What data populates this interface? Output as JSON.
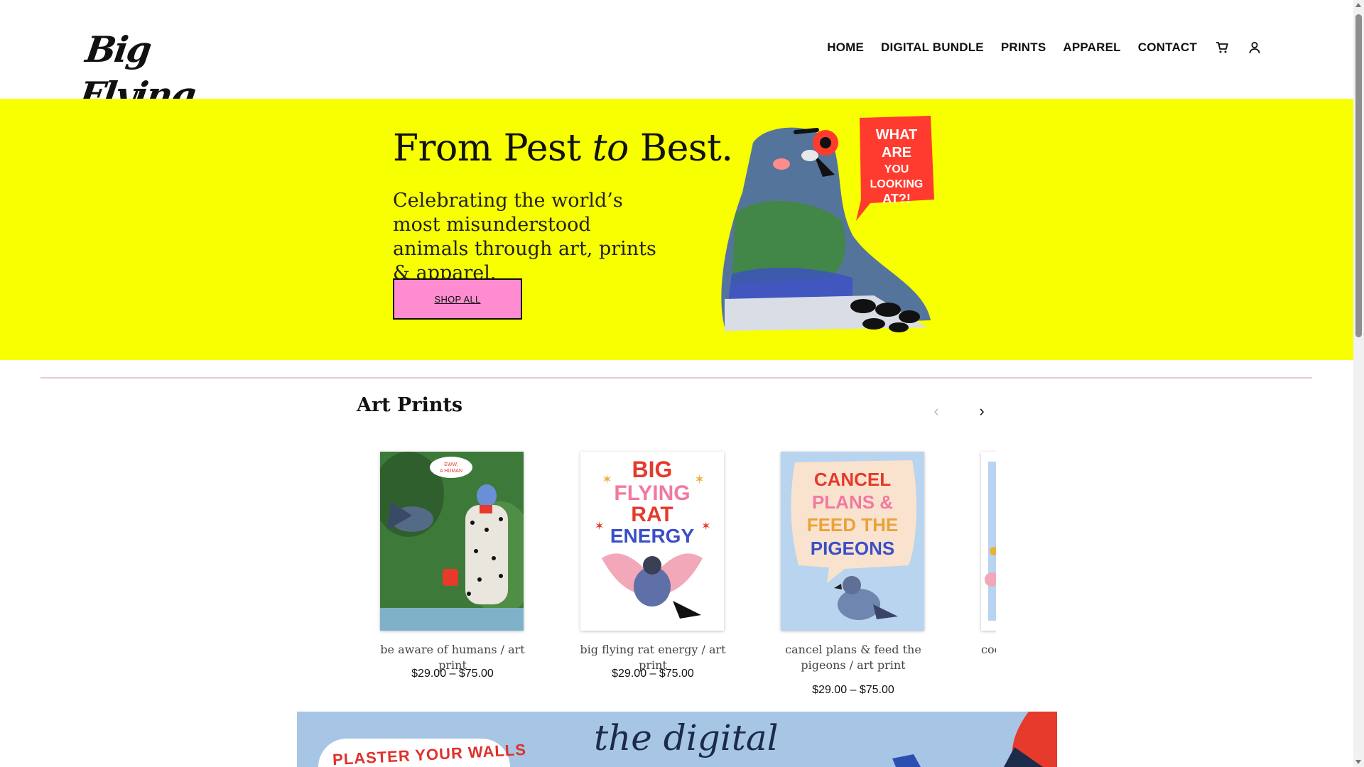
{
  "header": {
    "logo_text": "Big Flying Rat",
    "nav": [
      {
        "label": "HOME"
      },
      {
        "label": "DIGITAL BUNDLE"
      },
      {
        "label": "PRINTS"
      },
      {
        "label": "APPAREL"
      },
      {
        "label": "CONTACT"
      }
    ],
    "cart_icon": "cart-icon",
    "account_icon": "user-icon"
  },
  "hero": {
    "title_part1": "From Pest ",
    "title_italic": "to",
    "title_part2": " Best.",
    "subtitle": "Celebrating the world’s most misunderstood animals through art, prints & apparel.",
    "button_label": "SHOP ALL",
    "speech_bubble": "WHAT ARE YOU LOOKING AT?!",
    "background_color": "#f7ff00",
    "button_color": "#ff8cd1"
  },
  "art_prints": {
    "title": "Art Prints",
    "prev_icon": "chevron-left-icon",
    "next_icon": "chevron-right-icon",
    "products": [
      {
        "name": "be aware of humans / art print",
        "price": "$29.00 – $75.00",
        "art_text": "EWW, A HUMAN"
      },
      {
        "name": "big flying rat energy / art print",
        "price": "$29.00 – $75.00",
        "art_text": "BIG FLYING RAT ENERGY"
      },
      {
        "name": "cancel plans & feed the pigeons / art print",
        "price": "$29.00 – $75.00",
        "art_text": "CANCEL PLANS & FEED THE PIGEONS"
      },
      {
        "name": "coo-",
        "price": ""
      }
    ]
  },
  "banner": {
    "bubble_text": "PLASTER YOUR WALLS",
    "script_text": "the digital"
  }
}
